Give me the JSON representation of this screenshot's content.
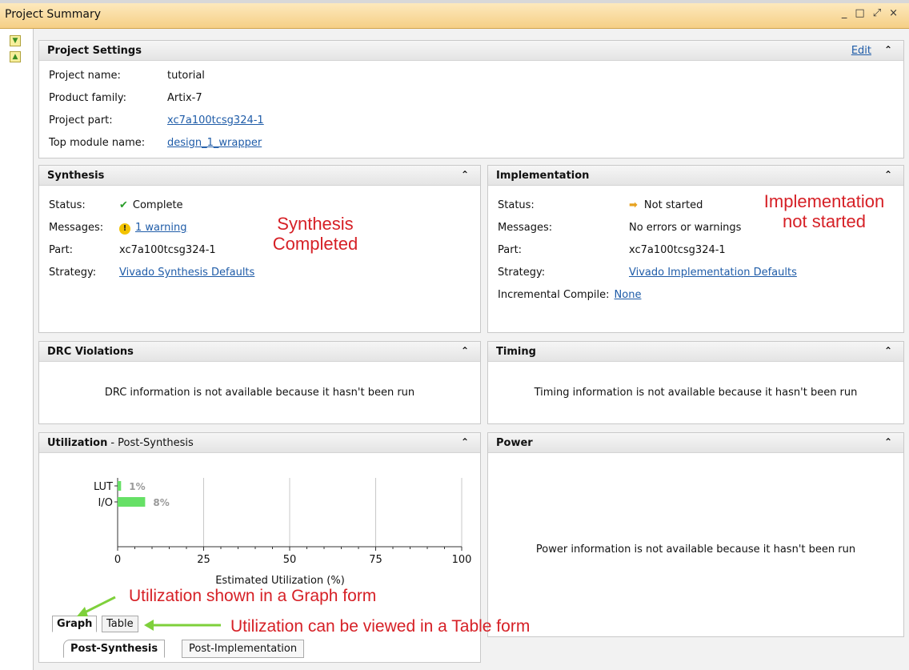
{
  "window": {
    "title": "Project Summary",
    "controls": [
      "_",
      "□",
      "⤢",
      "×"
    ]
  },
  "sidebar": {
    "icons": [
      "collapse-all-icon",
      "expand-all-icon"
    ]
  },
  "settings": {
    "title": "Project Settings",
    "edit": "Edit",
    "rows": [
      {
        "label": "Project name:",
        "value": "tutorial",
        "link": false
      },
      {
        "label": "Product family:",
        "value": "Artix-7",
        "link": false
      },
      {
        "label": "Project part:",
        "value": "xc7a100tcsg324-1",
        "link": true
      },
      {
        "label": "Top module name:",
        "value": "design_1_wrapper",
        "link": true
      }
    ]
  },
  "synthesis": {
    "title": "Synthesis",
    "status_label": "Status:",
    "status_value": "Complete",
    "messages_label": "Messages:",
    "messages_value": "1 warning",
    "part_label": "Part:",
    "part_value": "xc7a100tcsg324-1",
    "strategy_label": "Strategy:",
    "strategy_value": "Vivado Synthesis Defaults",
    "annotation": "Synthesis\nCompleted"
  },
  "implementation": {
    "title": "Implementation",
    "status_label": "Status:",
    "status_value": "Not started",
    "messages_label": "Messages:",
    "messages_value": "No errors or warnings",
    "part_label": "Part:",
    "part_value": "xc7a100tcsg324-1",
    "strategy_label": "Strategy:",
    "strategy_value": "Vivado Implementation Defaults",
    "incremental_label": "Incremental Compile:",
    "incremental_value": "None",
    "annotation": "Implementation\nnot started"
  },
  "drc": {
    "title": "DRC Violations",
    "message": "DRC information is not available because it hasn't been run"
  },
  "timing": {
    "title": "Timing",
    "message": "Timing information is not available because it hasn't been run"
  },
  "utilization": {
    "title": "Utilization",
    "subtitle": "- Post-Synthesis",
    "tabs": [
      "Graph",
      "Table"
    ],
    "bottom_tabs": [
      "Post-Synthesis",
      "Post-Implementation"
    ],
    "annotation_graph": "Utilization shown in a Graph form",
    "annotation_table": "Utilization can be viewed in a Table form"
  },
  "power": {
    "title": "Power",
    "message": "Power information is not available because it hasn't been run"
  },
  "colors": {
    "bar": "#66e066",
    "annotation": "#d62026",
    "arrow": "#7ed03b",
    "link": "#1f5ca8"
  },
  "chart_data": {
    "type": "bar",
    "orientation": "horizontal",
    "categories": [
      "LUT",
      "I/O"
    ],
    "values": [
      1,
      8
    ],
    "value_labels": [
      "1%",
      "8%"
    ],
    "xlabel": "Estimated Utilization (%)",
    "ylabel": "",
    "xlim": [
      0,
      100
    ],
    "xticks": [
      0,
      25,
      50,
      75,
      100
    ],
    "grid": true
  }
}
